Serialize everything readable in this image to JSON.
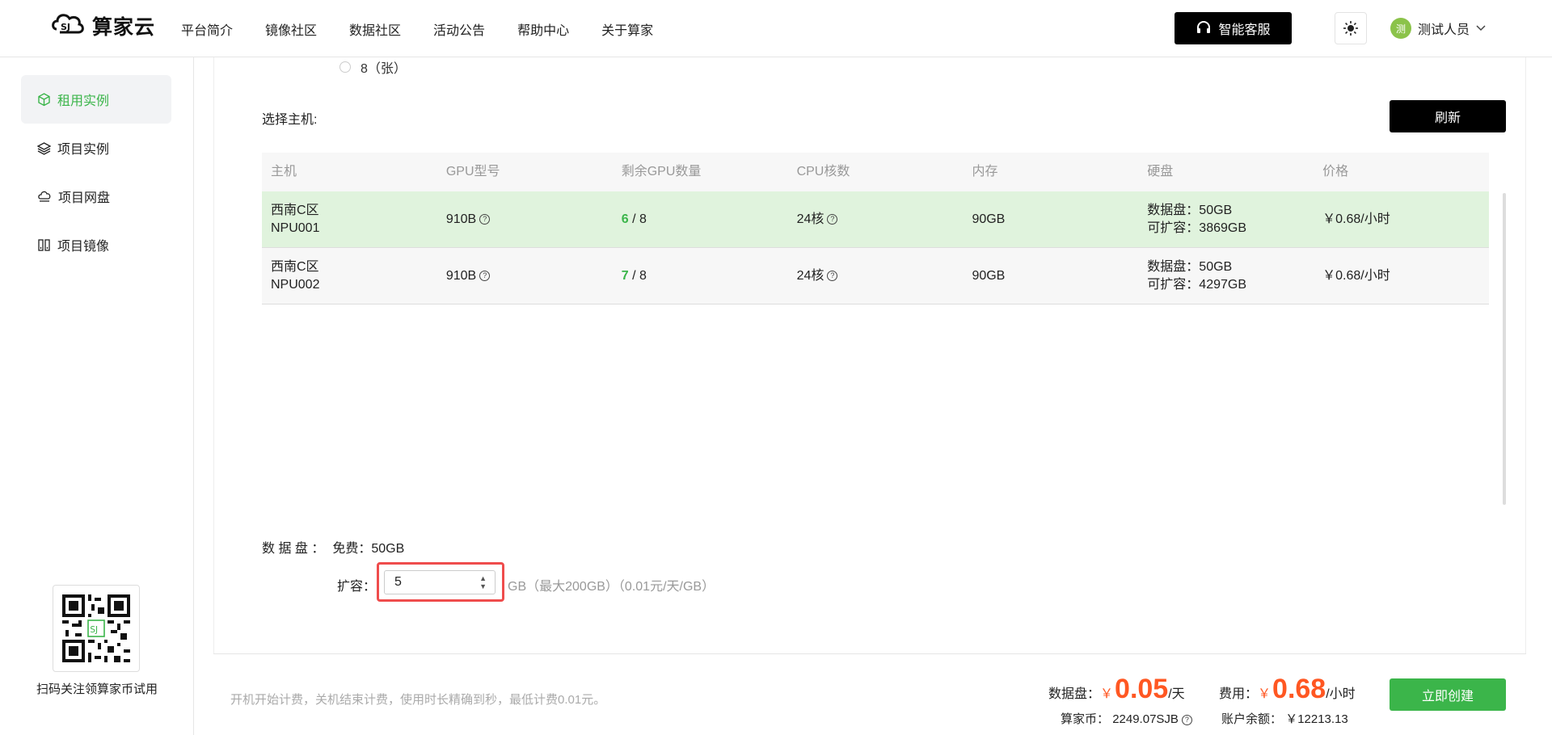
{
  "header": {
    "brand": "算家云",
    "nav": [
      "平台简介",
      "镜像社区",
      "数据社区",
      "活动公告",
      "帮助中心",
      "关于算家"
    ],
    "service_button": "智能客服",
    "user_avatar": "测",
    "user_name": "测试人员"
  },
  "sidebar": {
    "items": [
      {
        "label": "租用实例",
        "icon": "cube-icon"
      },
      {
        "label": "项目实例",
        "icon": "layers-icon"
      },
      {
        "label": "项目网盘",
        "icon": "cloud-disk-icon"
      },
      {
        "label": "项目镜像",
        "icon": "image-icon"
      }
    ],
    "qr_caption": "扫码关注领算家币试用"
  },
  "gpu_option": "8（张）",
  "host_select": {
    "label": "选择主机:",
    "refresh_button": "刷新",
    "columns": [
      "主机",
      "GPU型号",
      "剩余GPU数量",
      "CPU核数",
      "内存",
      "硬盘",
      "价格"
    ],
    "rows": [
      {
        "host_line1": "西南C区",
        "host_line2": "NPU001",
        "gpu_model": "910B",
        "gpu_free": "6",
        "gpu_total": " / 8",
        "cpu": "24核",
        "memory": "90GB",
        "disk_line1": "数据盘：50GB",
        "disk_line2": "可扩容：3869GB",
        "price": "￥0.68/小时"
      },
      {
        "host_line1": "西南C区",
        "host_line2": "NPU002",
        "gpu_model": "910B",
        "gpu_free": "7",
        "gpu_total": " / 8",
        "cpu": "24核",
        "memory": "90GB",
        "disk_line1": "数据盘：50GB",
        "disk_line2": "可扩容：4297GB",
        "price": "￥0.68/小时"
      }
    ]
  },
  "data_disk": {
    "label": "数 据 盘 ：",
    "free": "免费：50GB",
    "expand_label": "扩容：",
    "expand_value": "5",
    "hint": "GB（最大200GB）（0.01元/天/GB）"
  },
  "footer": {
    "note": "开机开始计费，关机结束计费，使用时长精确到秒，最低计费0.01元。",
    "disk_label": "数据盘：",
    "disk_price": "0.05",
    "disk_unit": "/天",
    "fee_label": "费用：",
    "fee_price": "0.68",
    "fee_unit": "/小时",
    "yen": "￥",
    "coin_label": "算家币：",
    "coin_value": "2249.07SJB",
    "balance_label": "账户余额：",
    "balance_value": "￥12213.13",
    "create_button": "立即创建"
  },
  "colors": {
    "accent": "#3bb54a",
    "price": "#ff5722",
    "highlight_border": "#ef4c4c"
  }
}
